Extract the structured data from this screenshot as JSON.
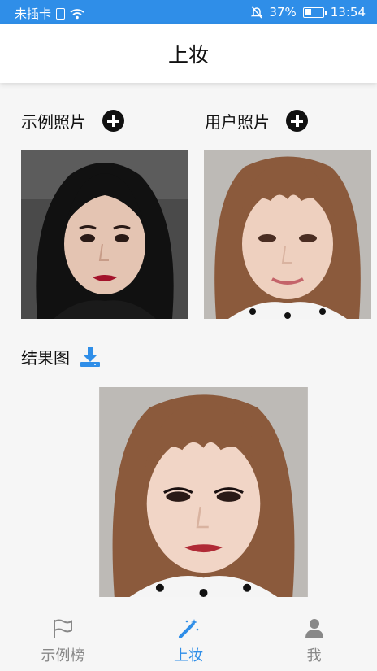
{
  "status_bar": {
    "carrier": "未插卡",
    "battery_percent": "37%",
    "battery_level": 0.37,
    "time": "13:54",
    "icons": [
      "sim-icon",
      "wifi-icon",
      "mute-bell-icon",
      "battery-icon"
    ]
  },
  "header": {
    "title": "上妆"
  },
  "sample_section": {
    "label": "示例照片",
    "add_icon": "plus-circle-icon"
  },
  "user_section": {
    "label": "用户照片",
    "add_icon": "plus-circle-icon"
  },
  "result_section": {
    "label": "结果图",
    "download_icon": "download-icon"
  },
  "bottom_nav": {
    "items": [
      {
        "label": "示例榜",
        "icon": "flag-icon",
        "active": false
      },
      {
        "label": "上妆",
        "icon": "magic-wand-icon",
        "active": true
      },
      {
        "label": "我",
        "icon": "person-icon",
        "active": false
      }
    ]
  },
  "colors": {
    "accent": "#2f8ee8",
    "inactive": "#888888",
    "background": "#f6f6f6"
  }
}
